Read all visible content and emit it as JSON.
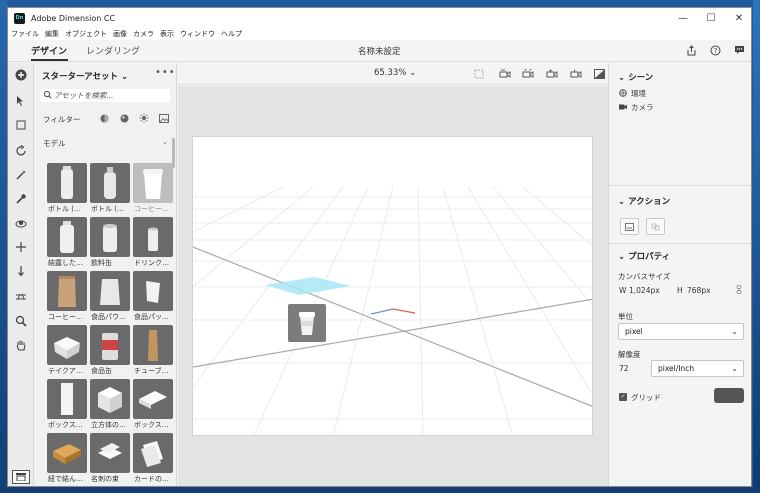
{
  "window": {
    "app_icon_text": "Dn",
    "title": "Adobe Dimension CC",
    "controls": [
      "—",
      "☐",
      "✕"
    ]
  },
  "menu": [
    "ファイル",
    "編集",
    "オブジェクト",
    "画像",
    "カメラ",
    "表示",
    "ウィンドウ",
    "ヘルプ"
  ],
  "tabs": [
    {
      "label": "デザイン",
      "active": true
    },
    {
      "label": "レンダリング",
      "active": false
    }
  ],
  "document_title": "名称未設定",
  "header_icons": [
    "share-icon",
    "help-icon",
    "comment-icon"
  ],
  "tools": [
    "add-icon",
    "select-icon",
    "frame-icon",
    "orbit-icon",
    "magic-wand-icon",
    "sample-icon",
    "pan-view-icon",
    "move-icon",
    "dolly-icon",
    "horizon-icon",
    "zoom-icon",
    "hand-icon"
  ],
  "assets": {
    "title": "スターターアセット",
    "more": "•••",
    "search_placeholder": "アセットを検索...",
    "filter_label": "フィルター",
    "filter_icons": [
      "model-filter-icon",
      "material-filter-icon",
      "light-filter-icon",
      "image-filter-icon"
    ],
    "section": "モデル",
    "items": [
      {
        "label": "ボトル (…",
        "shade": "dark"
      },
      {
        "label": "ボトル (…",
        "shade": "dark"
      },
      {
        "label": "コーヒー…",
        "shade": "light"
      },
      {
        "label": "結露した…",
        "shade": "dark"
      },
      {
        "label": "飲料缶",
        "shade": "dark"
      },
      {
        "label": "ドリンク…",
        "shade": "dark"
      },
      {
        "label": "コーヒー…",
        "shade": "dark"
      },
      {
        "label": "食品パウ…",
        "shade": "dark"
      },
      {
        "label": "食品パッ…",
        "shade": "dark"
      },
      {
        "label": "テイクア…",
        "shade": "dark"
      },
      {
        "label": "食品缶",
        "shade": "dark"
      },
      {
        "label": "チューブ…",
        "shade": "dark"
      },
      {
        "label": "ボックス…",
        "shade": "dark"
      },
      {
        "label": "立方体の…",
        "shade": "dark"
      },
      {
        "label": "ボックス…",
        "shade": "dark"
      },
      {
        "label": "紐で結ん…",
        "shade": "dark"
      },
      {
        "label": "名刺の束",
        "shade": "dark"
      },
      {
        "label": "カードの…",
        "shade": "dark"
      }
    ]
  },
  "viewport": {
    "zoom": "65.33%",
    "tool_icons": [
      "fit-frame-icon",
      "camera-move-icon",
      "camera-orbit-icon",
      "camera-pan-icon",
      "camera-dolly-icon",
      "render-preview-icon"
    ]
  },
  "scene_panel": {
    "title": "シーン",
    "items": [
      {
        "icon": "environment-icon",
        "label": "環境"
      },
      {
        "icon": "camera-icon",
        "label": "カメラ"
      }
    ]
  },
  "actions_panel": {
    "title": "アクション"
  },
  "properties_panel": {
    "title": "プロパティ",
    "canvas_size_label": "カンバスサイズ",
    "w_label": "W",
    "w_value": "1,024px",
    "h_label": "H",
    "h_value": "768px",
    "unit_label": "単位",
    "unit_value": "pixel",
    "resolution_label": "解像度",
    "resolution_value": "72",
    "resolution_unit": "pixel/Inch",
    "grid_label": "グリッド",
    "grid_checked": true,
    "grid_color": "#555555"
  }
}
